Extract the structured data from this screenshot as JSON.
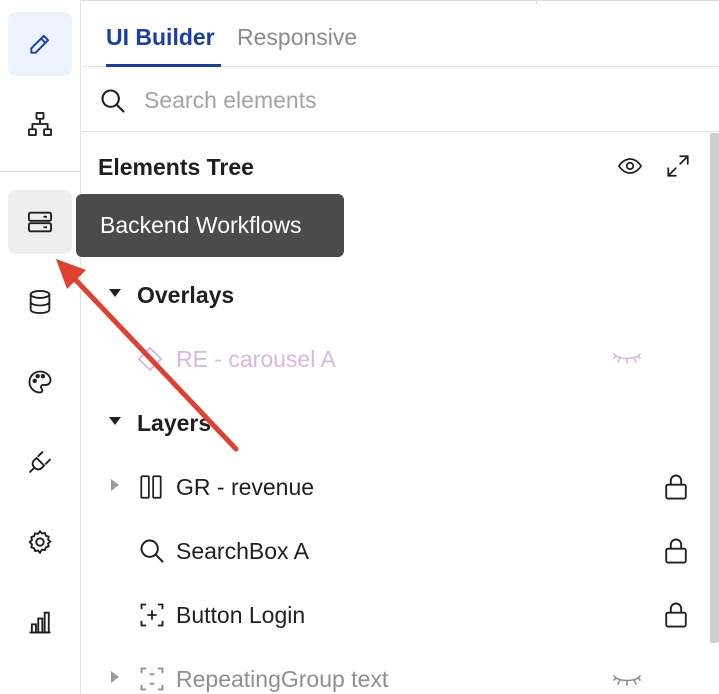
{
  "rail": {
    "items": [
      {
        "icon": "pencil-icon",
        "state": "active"
      },
      {
        "icon": "sitemap-icon",
        "state": "normal"
      },
      {
        "icon": "server-icon",
        "state": "hover"
      },
      {
        "icon": "database-icon",
        "state": "normal"
      },
      {
        "icon": "palette-icon",
        "state": "normal"
      },
      {
        "icon": "plug-icon",
        "state": "normal"
      },
      {
        "icon": "gear-icon",
        "state": "normal"
      },
      {
        "icon": "bar-chart-icon",
        "state": "normal"
      }
    ]
  },
  "tabs": {
    "active": "UI Builder",
    "inactive": "Responsive"
  },
  "search": {
    "placeholder": "Search elements"
  },
  "tree": {
    "title": "Elements Tree",
    "groups": {
      "overlays": "Overlays",
      "layers": "Layers"
    },
    "items": {
      "carousel": "RE - carousel A",
      "revenue": "GR - revenue",
      "searchbox": "SearchBox A",
      "login": "Button Login",
      "repeating": "RepeatingGroup text"
    }
  },
  "tooltip": {
    "text": "Backend Workflows"
  },
  "colors": {
    "accent": "#1a3ea8",
    "tooltip_bg": "#4b4b4b",
    "hidden_item": "#d7b8e4",
    "annotation_arrow": "#e0402f"
  }
}
